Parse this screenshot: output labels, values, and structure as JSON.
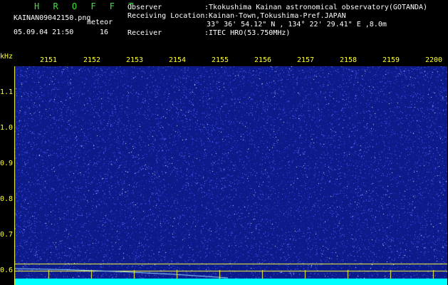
{
  "header": {
    "app_title": "H R O F F T",
    "filename": "KAINAN09042150.png",
    "meteor_label": "meteor",
    "datetime": "05.09.04 21:50",
    "meteor_count": "16",
    "observer_label": "Observer",
    "observer_value": ":Tkokushima Kainan astronomical observatory(GOTANDA)",
    "location_label": "Receiving Location",
    "location_value": ":Kainan-Town,Tokushima-Pref.JAPAN",
    "coordinates": "33° 36' 54.12\" N , 134° 22' 29.41\" E ,8.0m",
    "receiver_label": "Receiver",
    "receiver_value": ":ITEC HRO(53.750MHz)"
  },
  "axis": {
    "y_unit": "kHz",
    "x_ticks": [
      "2151",
      "2152",
      "2153",
      "2154",
      "2155",
      "2156",
      "2157",
      "2158",
      "2159",
      "2200"
    ],
    "y_ticks": [
      "1.1",
      "1.0",
      "0.9",
      "0.8",
      "0.7",
      "0.6"
    ]
  },
  "colors": {
    "background": "#000000",
    "plot_bg": "#0c1a8a",
    "noise": "#5a6cff",
    "grid": "#ffff33",
    "band": "#00ffff",
    "label_green": "#39e639"
  }
}
